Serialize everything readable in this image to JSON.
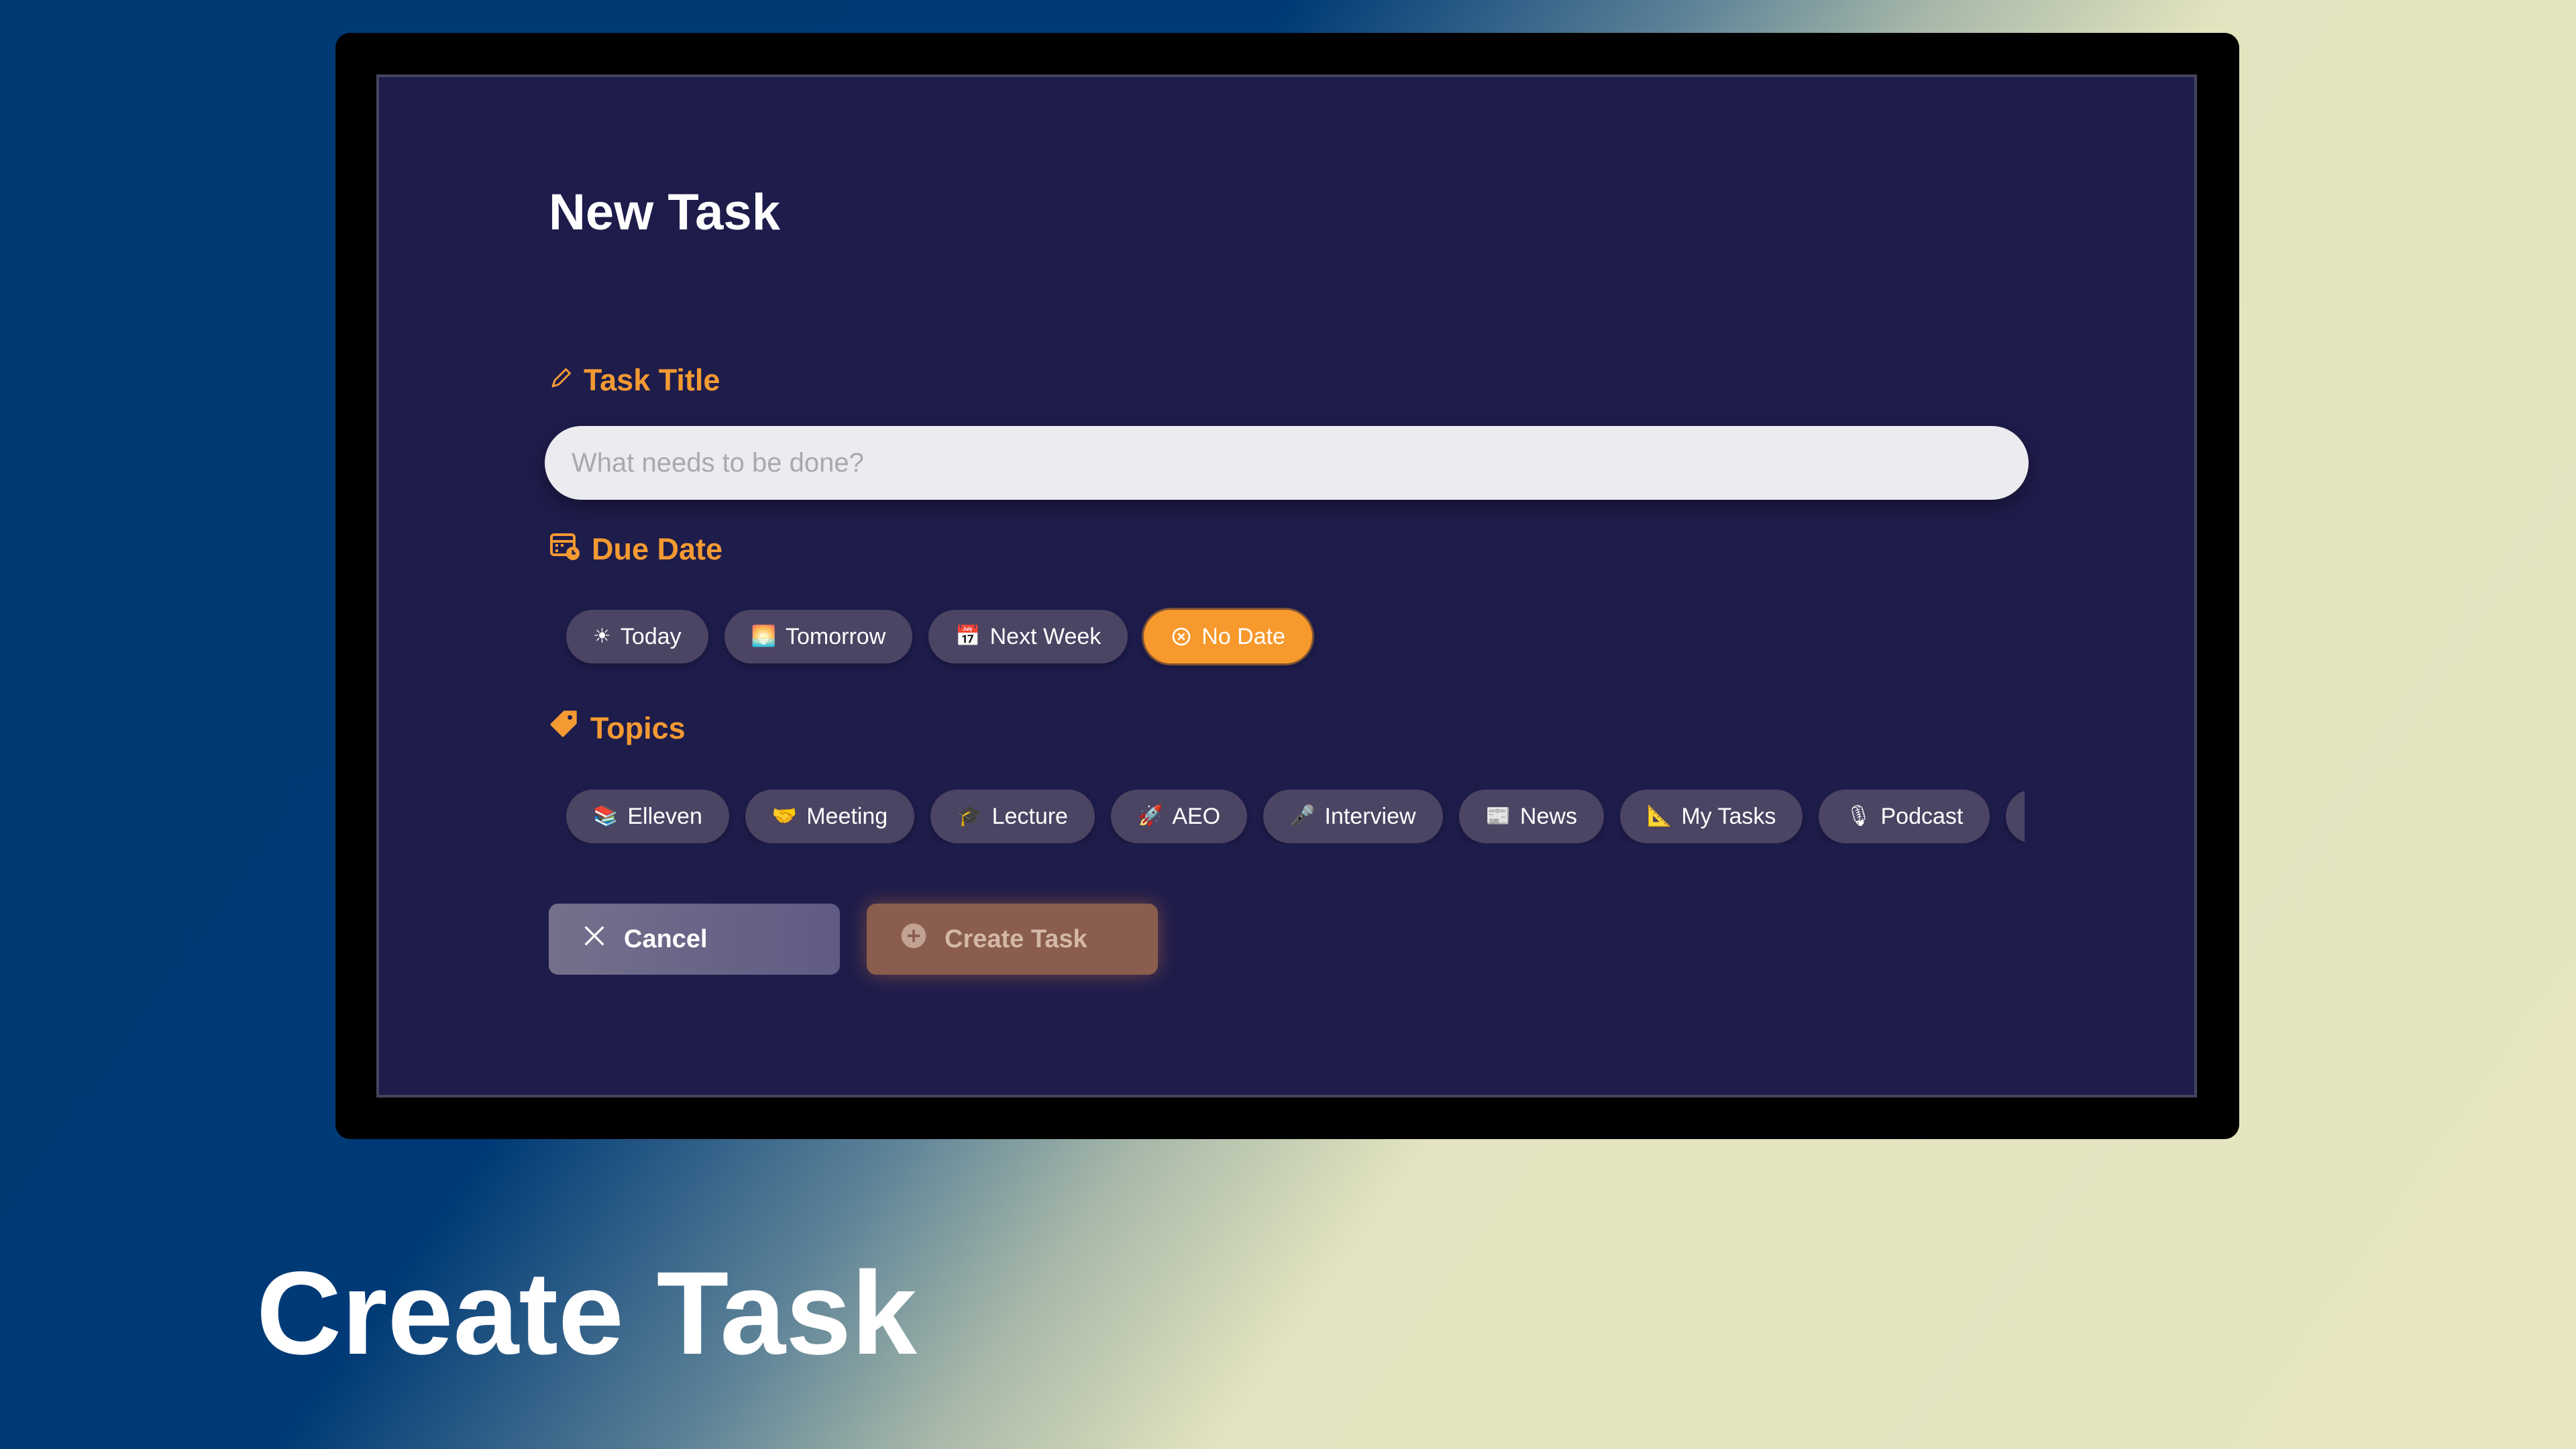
{
  "dialog": {
    "title": "New Task",
    "task_title": {
      "label": "Task Title",
      "placeholder": "What needs to be done?",
      "value": ""
    },
    "due_date": {
      "label": "Due Date",
      "options": [
        {
          "icon": "sun-icon",
          "glyph": "☀",
          "label": "Today",
          "selected": false
        },
        {
          "icon": "sunrise-icon",
          "glyph": "🌅",
          "label": "Tomorrow",
          "selected": false
        },
        {
          "icon": "calendar-icon",
          "glyph": "📅",
          "label": "Next Week",
          "selected": false
        },
        {
          "icon": "no-date-icon",
          "glyph": "⊗",
          "label": "No Date",
          "selected": true
        }
      ]
    },
    "topics": {
      "label": "Topics",
      "items": [
        {
          "icon": "books-icon",
          "glyph": "📚",
          "label": "Elleven"
        },
        {
          "icon": "handshake-icon",
          "glyph": "🤝",
          "label": "Meeting"
        },
        {
          "icon": "graduation-cap-icon",
          "glyph": "🎓",
          "label": "Lecture"
        },
        {
          "icon": "rocket-icon",
          "glyph": "🚀",
          "label": "AEO"
        },
        {
          "icon": "microphone-icon",
          "glyph": "🎤",
          "label": "Interview"
        },
        {
          "icon": "newspaper-icon",
          "glyph": "📰",
          "label": "News"
        },
        {
          "icon": "triangle-ruler-icon",
          "glyph": "📐",
          "label": "My Tasks"
        },
        {
          "icon": "studio-microphone-icon",
          "glyph": "🎙",
          "label": "Podcast"
        },
        {
          "icon": "bar-chart-icon",
          "glyph": "📊",
          "label": ""
        }
      ]
    },
    "buttons": {
      "cancel": "Cancel",
      "create": "Create Task"
    }
  },
  "caption": "Create Task",
  "colors": {
    "accent": "#f49a32",
    "screen_bg": "#1e1c4b",
    "chip_bg": "#4b4463",
    "chip_active_bg": "#f7992c"
  }
}
